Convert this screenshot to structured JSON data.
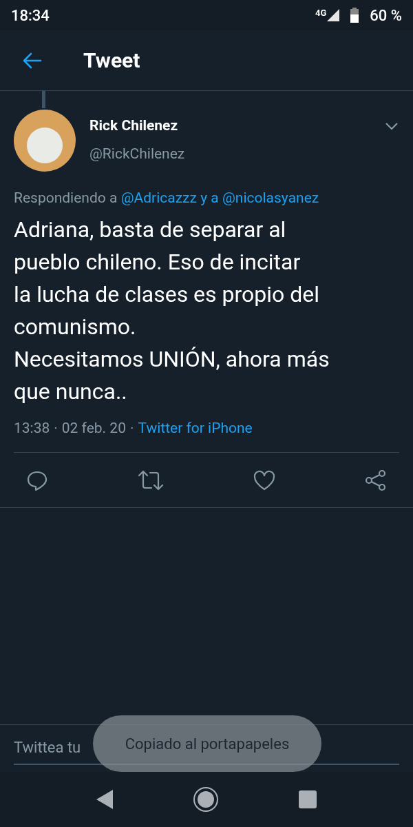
{
  "status_bar": {
    "time": "18:34",
    "network": "4G",
    "battery": "60 %"
  },
  "header": {
    "title": "Tweet"
  },
  "tweet": {
    "name": "Rick Chilenez",
    "handle": "@RickChilenez",
    "replying": {
      "prefix": "Respondiendo a",
      "users": [
        "@Adricazzz",
        "@nicolasyanez"
      ],
      "joiner": "y a"
    },
    "text": "Adriana, basta de separar al\npueblo chileno. Eso de incitar\nla lucha de clases es propio del\ncomunismo.\nNecesitamos UNIÓN, ahora más\nque nunca..",
    "time": "13:38",
    "separator": "·",
    "date": "02 feb. 20",
    "source": "Twitter for iPhone"
  },
  "reply": {
    "placeholder": "Twittea tu"
  },
  "toast": "Copiado al portapapeles"
}
